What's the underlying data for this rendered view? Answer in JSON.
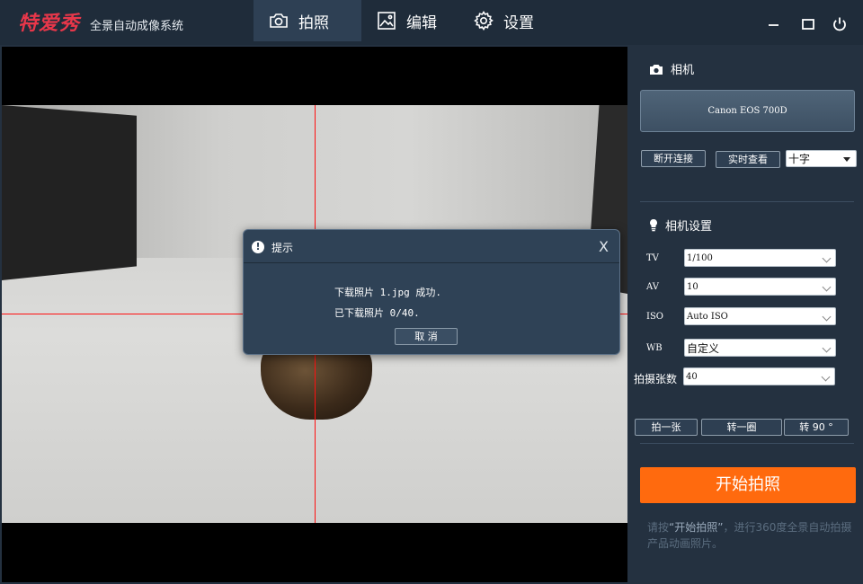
{
  "app": {
    "logo_main": "特爱秀",
    "logo_sub": "全景自动成像系统"
  },
  "tabs": [
    {
      "label": "拍照",
      "icon": "camera-icon",
      "active": true
    },
    {
      "label": "编辑",
      "icon": "image-edit-icon",
      "active": false
    },
    {
      "label": "设置",
      "icon": "gear-icon",
      "active": false
    }
  ],
  "window_controls": [
    "minimize-icon",
    "maximize-icon",
    "power-icon"
  ],
  "dialog": {
    "title": "提示",
    "close": "X",
    "line1": "下载照片 1.jpg 成功.",
    "line2": "已下载照片 0/40.",
    "cancel": "取 消"
  },
  "camera": {
    "section_title": "相机",
    "model": "Canon EOS 700D",
    "disconnect": "断开连接",
    "live_view": "实时查看",
    "overlay_select": "十字"
  },
  "settings": {
    "section_title": "相机设置",
    "tv": {
      "label": "TV",
      "value": "1/100"
    },
    "av": {
      "label": "AV",
      "value": "10"
    },
    "iso": {
      "label": "ISO",
      "value": "Auto ISO"
    },
    "wb": {
      "label": "WB",
      "value": "自定义"
    },
    "count": {
      "label": "拍摄张数",
      "value": "40"
    }
  },
  "actions": {
    "shoot_one": "拍一张",
    "rotate_round": "转一圈",
    "rotate_90": "转 90 °"
  },
  "start": {
    "label": "开始拍照",
    "hint_prefix": "请按",
    "hint_button": "“开始拍照”",
    "hint_suffix": "，进行360度全景自动拍摄产品动画照片。"
  },
  "colors": {
    "accent": "#ff6a0e",
    "crosshair": "#ff1010",
    "logo": "#e8374a",
    "background": "#243140"
  }
}
